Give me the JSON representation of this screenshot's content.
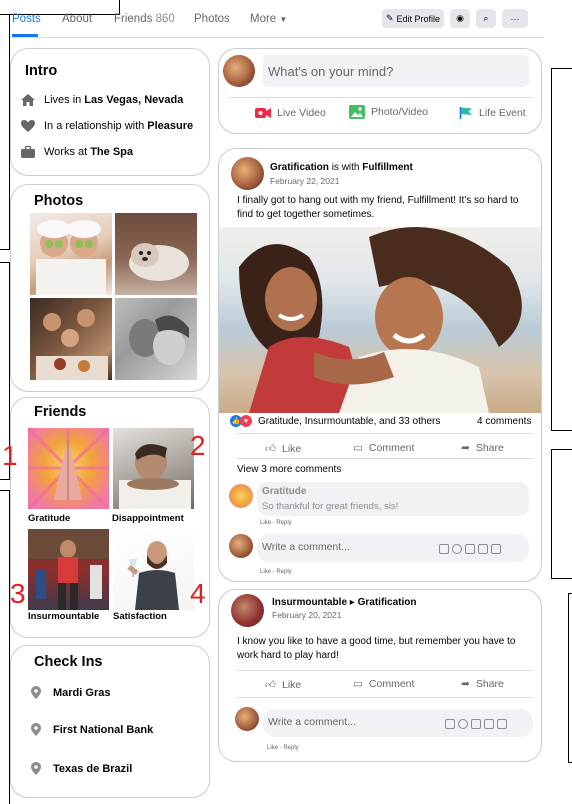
{
  "nav": {
    "tabs": [
      "Posts",
      "About",
      "Friends",
      "Photos",
      "More"
    ],
    "friends_count": "860",
    "edit_profile": "Edit Profile"
  },
  "intro": {
    "title": "Intro",
    "lives_prefix": "Lives in",
    "lives_value": "Las Vegas, Nevada",
    "relationship_prefix": "In a relationship with",
    "relationship_value": "Pleasure",
    "works_prefix": "Works at",
    "works_value": "The Spa"
  },
  "photos": {
    "title": "Photos"
  },
  "friends": {
    "title": "Friends",
    "items": [
      {
        "name": "Gratitude",
        "number": "1"
      },
      {
        "name": "Disappointment",
        "number": "2"
      },
      {
        "name": "Insurmountable",
        "number": "3"
      },
      {
        "name": "Satisfaction",
        "number": "4"
      }
    ]
  },
  "checkins": {
    "title": "Check Ins",
    "items": [
      "Mardi Gras",
      "First National Bank",
      "Texas de Brazil"
    ]
  },
  "composer": {
    "placeholder": "What's on your mind?",
    "live_video": "Live Video",
    "photo_video": "Photo/Video",
    "life_event": "Life Event"
  },
  "post1": {
    "author": "Gratification",
    "with_text": "is with",
    "tagged": "Fulfillment",
    "date": "February 22, 2021",
    "text": "I finally got to hang out with my friend, Fulfillment! It's so hard to find to get together  sometimes.",
    "reactions": "Gratitude, Insurmountable, and 33 others",
    "comments_count": "4 comments",
    "like": "Like",
    "comment": "Comment",
    "share": "Share",
    "view_more": "View 3 more comments",
    "comment_author": "Gratitude",
    "comment_text": "So thankful for great friends, sis!",
    "like_reply": "Like · Reply",
    "write_comment": "Write a comment...",
    "like_reply_2": "Like · Reply"
  },
  "post2": {
    "author": "Insurmountable",
    "arrow": "▸",
    "target": "Gratification",
    "date": "February 20, 2021",
    "text": "I know you like to have a good time, but remember  you have to work hard to play hard!",
    "like": "Like",
    "comment": "Comment",
    "share": "Share",
    "write_comment": "Write a comment...",
    "like_reply": "Like · Reply"
  },
  "colors": {
    "accent": "#1877f2",
    "red_label": "#e41e1e"
  }
}
